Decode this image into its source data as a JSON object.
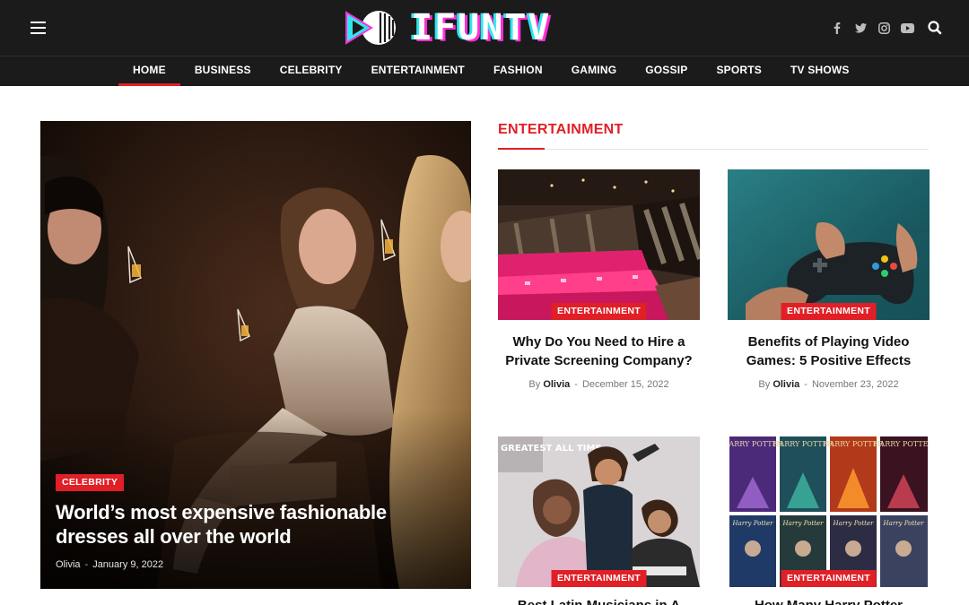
{
  "site": {
    "logo_text": "IFUNTV",
    "colors": {
      "header_bg": "#1b1b1b",
      "accent": "#e01f26",
      "logo_cyan": "#2fe6ef",
      "logo_magenta": "#ff2fd6"
    }
  },
  "header": {
    "menu_icon": "hamburger-icon",
    "social_icons": [
      "facebook-icon",
      "twitter-icon",
      "instagram-icon",
      "youtube-icon"
    ],
    "search_icon": "search-icon"
  },
  "nav": {
    "items": [
      {
        "label": "HOME",
        "active": true
      },
      {
        "label": "BUSINESS"
      },
      {
        "label": "CELEBRITY"
      },
      {
        "label": "ENTERTAINMENT"
      },
      {
        "label": "FASHION"
      },
      {
        "label": "GAMING"
      },
      {
        "label": "GOSSIP"
      },
      {
        "label": "SPORTS"
      },
      {
        "label": "TV SHOWS"
      }
    ]
  },
  "hero": {
    "category": "CELEBRITY",
    "title": "World’s most expensive fashionable dresses all over the world",
    "author": "Olivia",
    "separator": "-",
    "date": "January 9, 2022"
  },
  "section": {
    "title": "ENTERTAINMENT",
    "cards": [
      {
        "category": "ENTERTAINMENT",
        "title": "Why Do You Need to Hire a Private Screening Company?",
        "by": "By",
        "author": "Olivia",
        "separator": "-",
        "date": "December 15, 2022"
      },
      {
        "category": "ENTERTAINMENT",
        "title": "Benefits of Playing Video Games: 5 Positive Effects",
        "by": "By",
        "author": "Olivia",
        "separator": "-",
        "date": "November 23, 2022"
      },
      {
        "category": "ENTERTAINMENT",
        "title": "Best Latin Musicians in A",
        "image_text": "GREATEST ALL TIME"
      },
      {
        "category": "ENTERTAINMENT",
        "title": "How Many Harry Potter",
        "book_labels": [
          "HARRY POTTER",
          "Harry Potter"
        ]
      }
    ]
  }
}
